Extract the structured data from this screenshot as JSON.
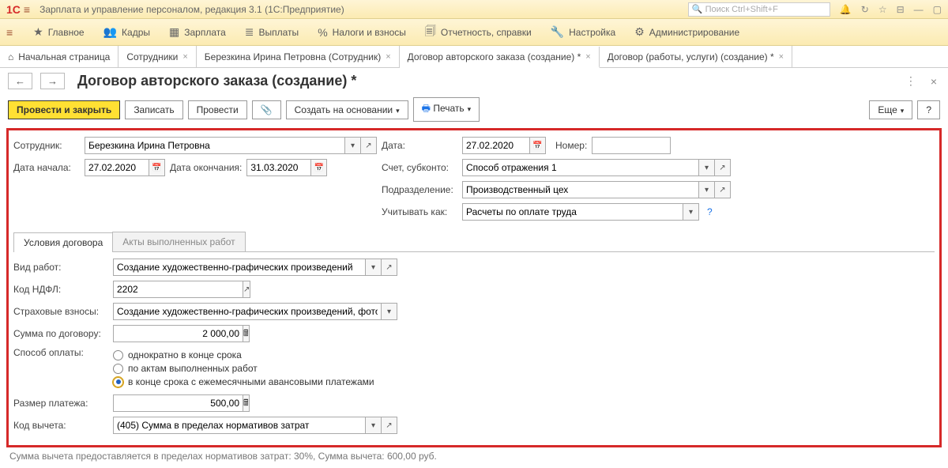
{
  "app": {
    "title": "Зарплата и управление персоналом, редакция 3.1  (1С:Предприятие)",
    "search_placeholder": "Поиск Ctrl+Shift+F"
  },
  "menu": [
    {
      "icon": "★",
      "label": "Главное"
    },
    {
      "icon": "👥",
      "label": "Кадры"
    },
    {
      "icon": "▦",
      "label": "Зарплата"
    },
    {
      "icon": "≣",
      "label": "Выплаты"
    },
    {
      "icon": "%",
      "label": "Налоги и взносы"
    },
    {
      "icon": "🗐",
      "label": "Отчетность, справки"
    },
    {
      "icon": "🔧",
      "label": "Настройка"
    },
    {
      "icon": "⚙",
      "label": "Администрирование"
    }
  ],
  "tabs": [
    {
      "label": "Начальная страница",
      "home": true
    },
    {
      "label": "Сотрудники"
    },
    {
      "label": "Березкина Ирина Петровна (Сотрудник)"
    },
    {
      "label": "Договор авторского заказа (создание) *",
      "active": true
    },
    {
      "label": "Договор (работы, услуги) (создание) *"
    }
  ],
  "page": {
    "title": "Договор авторского заказа (создание) *"
  },
  "toolbar": {
    "post_close": "Провести и закрыть",
    "save": "Записать",
    "post": "Провести",
    "create_on": "Создать на основании",
    "print": "Печать",
    "more": "Еще"
  },
  "fields": {
    "employee_label": "Сотрудник:",
    "employee": "Березкина Ирина Петровна",
    "date_label": "Дата:",
    "date": "27.02.2020",
    "number_label": "Номер:",
    "number": "",
    "start_label": "Дата начала:",
    "start": "27.02.2020",
    "end_label": "Дата окончания:",
    "end": "31.03.2020",
    "account_label": "Счет, субконто:",
    "account": "Способ отражения 1",
    "dept_label": "Подразделение:",
    "dept": "Производственный цех",
    "treat_label": "Учитывать как:",
    "treat": "Расчеты по оплате труда"
  },
  "innerTabs": {
    "t1": "Условия договора",
    "t2": "Акты выполненных работ"
  },
  "details": {
    "work_type_label": "Вид работ:",
    "work_type": "Создание художественно-графических произведений",
    "ndfl_label": "Код НДФЛ:",
    "ndfl": "2202",
    "contrib_label": "Страховые взносы:",
    "contrib": "Создание художественно-графических произведений, фотораб",
    "sum_label": "Сумма по договору:",
    "sum": "2 000,00",
    "pay_method_label": "Способ оплаты:",
    "pay_opt1": "однократно в конце срока",
    "pay_opt2": "по актам выполненных работ",
    "pay_opt3": "в конце срока с ежемесячными авансовыми платежами",
    "payment_size_label": "Размер платежа:",
    "payment_size": "500,00",
    "deduction_label": "Код вычета:",
    "deduction": "(405) Сумма в пределах нормативов затрат"
  },
  "footer": "Сумма вычета предоставляется в пределах нормативов затрат: 30%,  Сумма вычета: 600,00 руб."
}
